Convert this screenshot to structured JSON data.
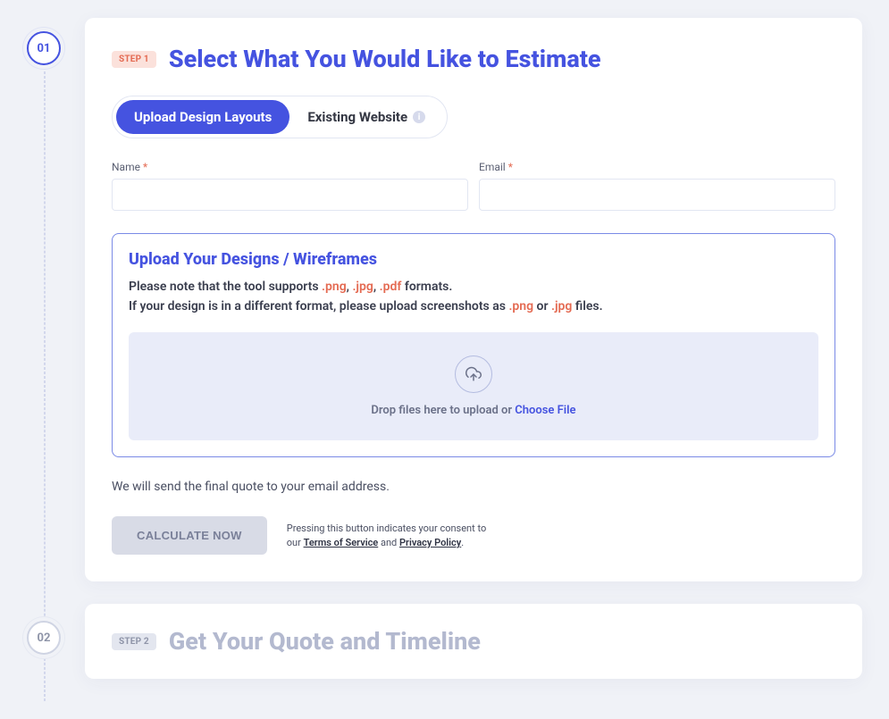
{
  "steps": {
    "rail": {
      "s1": "01",
      "s2": "02"
    }
  },
  "step1": {
    "badge": "STEP 1",
    "title": "Select What You Would Like to Estimate",
    "tabs": {
      "upload": "Upload Design Layouts",
      "existing": "Existing Website"
    },
    "fields": {
      "name_label": "Name",
      "name_req": "*",
      "email_label": "Email",
      "email_req": "*"
    },
    "upload_panel": {
      "title": "Upload Your Designs / Wireframes",
      "note_p1_pre": "Please note that the tool supports ",
      "ext_png": ".png",
      "sep1": ", ",
      "ext_jpg": ".jpg",
      "sep2": ", ",
      "ext_pdf": ".pdf",
      "note_p1_post": " formats.",
      "note_p2_pre": "If your design is in a different format, please upload screenshots as ",
      "ext_png2": ".png",
      "or": " or ",
      "ext_jpg2": ".jpg",
      "note_p2_post": " files.",
      "dropzone": {
        "text_pre": "Drop files here to upload or ",
        "link": "Choose File"
      }
    },
    "send_note": "We will send the final quote to your email address.",
    "calc_button": "CALCULATE NOW",
    "consent": {
      "pre": "Pressing this button indicates your consent to our ",
      "tos": "Terms of Service",
      "and": " and ",
      "pp": "Privacy Policy",
      "end": "."
    }
  },
  "step2": {
    "badge": "STEP 2",
    "title": "Get Your Quote and Timeline"
  }
}
